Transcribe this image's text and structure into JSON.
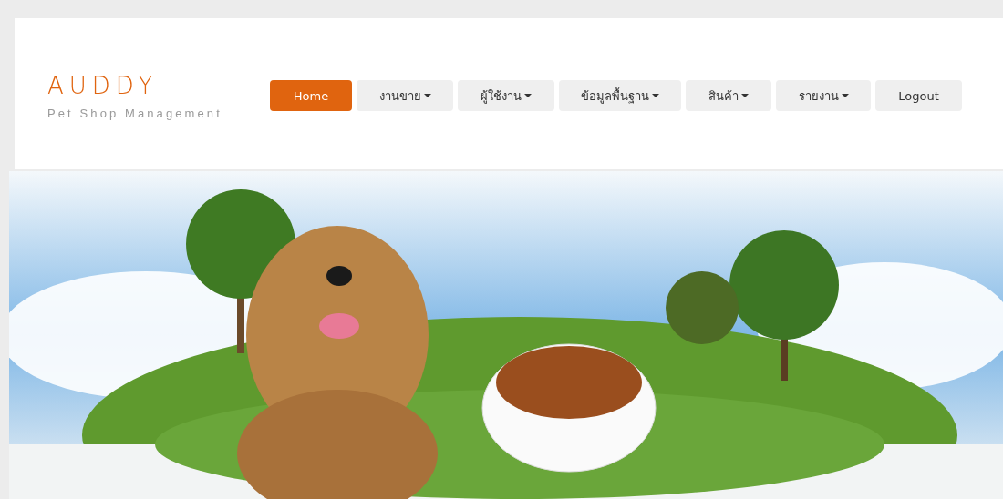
{
  "brand": {
    "title": "AUDDY",
    "subtitle": "Pet Shop Management"
  },
  "menu": [
    {
      "label": "Home",
      "kind": "link",
      "selected": true
    },
    {
      "label": "งานขาย",
      "kind": "dropdown",
      "selected": false
    },
    {
      "label": "ผู้ใช้งาน",
      "kind": "dropdown",
      "selected": false
    },
    {
      "label": "ข้อมูลพื้นฐาน",
      "kind": "dropdown",
      "selected": false
    },
    {
      "label": "สินค้า",
      "kind": "dropdown",
      "selected": false
    },
    {
      "label": "รายงาน",
      "kind": "dropdown",
      "selected": false
    },
    {
      "label": "Logout",
      "kind": "link",
      "selected": false
    }
  ]
}
